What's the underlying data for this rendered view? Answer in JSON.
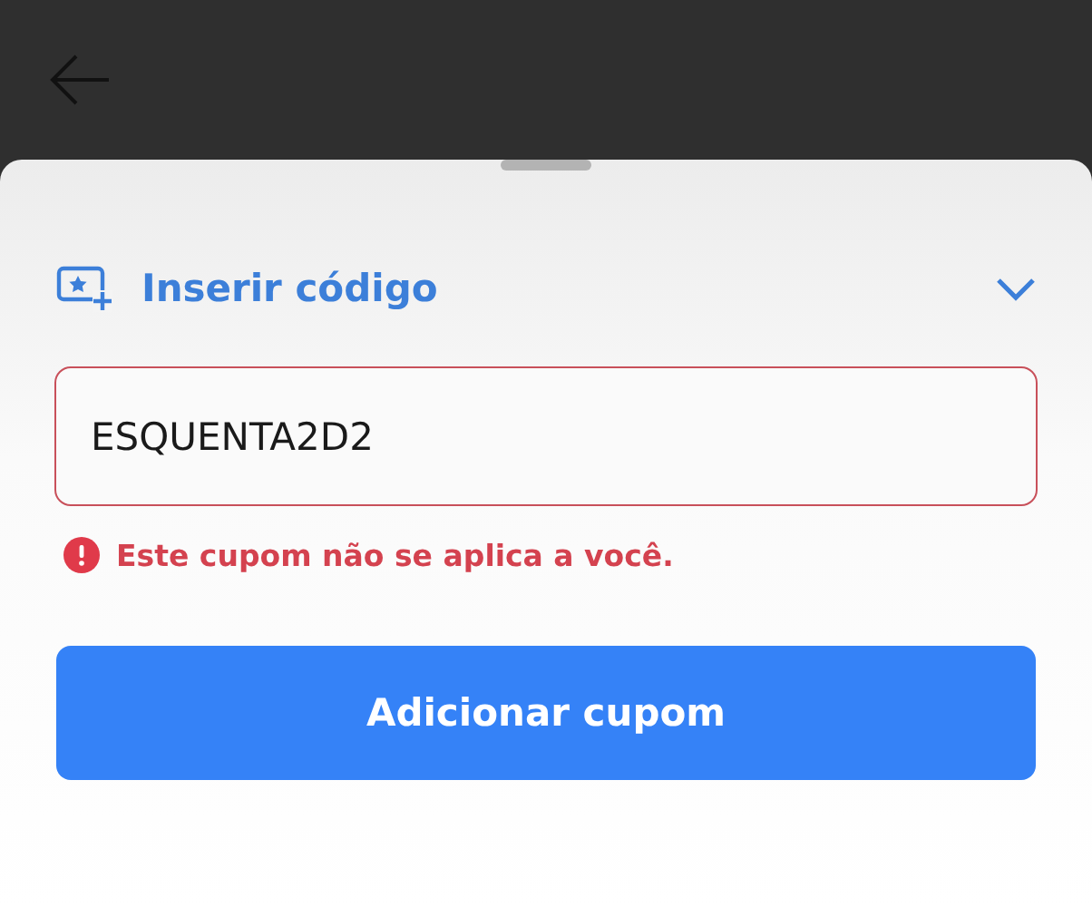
{
  "coupon_section": {
    "title": "Inserir código",
    "expanded": false
  },
  "coupon_field": {
    "value": "ESQUENTA2D2",
    "invalid": true
  },
  "error_message": "Este cupom não se aplica a você.",
  "submit_button": "Adicionar cupom"
}
